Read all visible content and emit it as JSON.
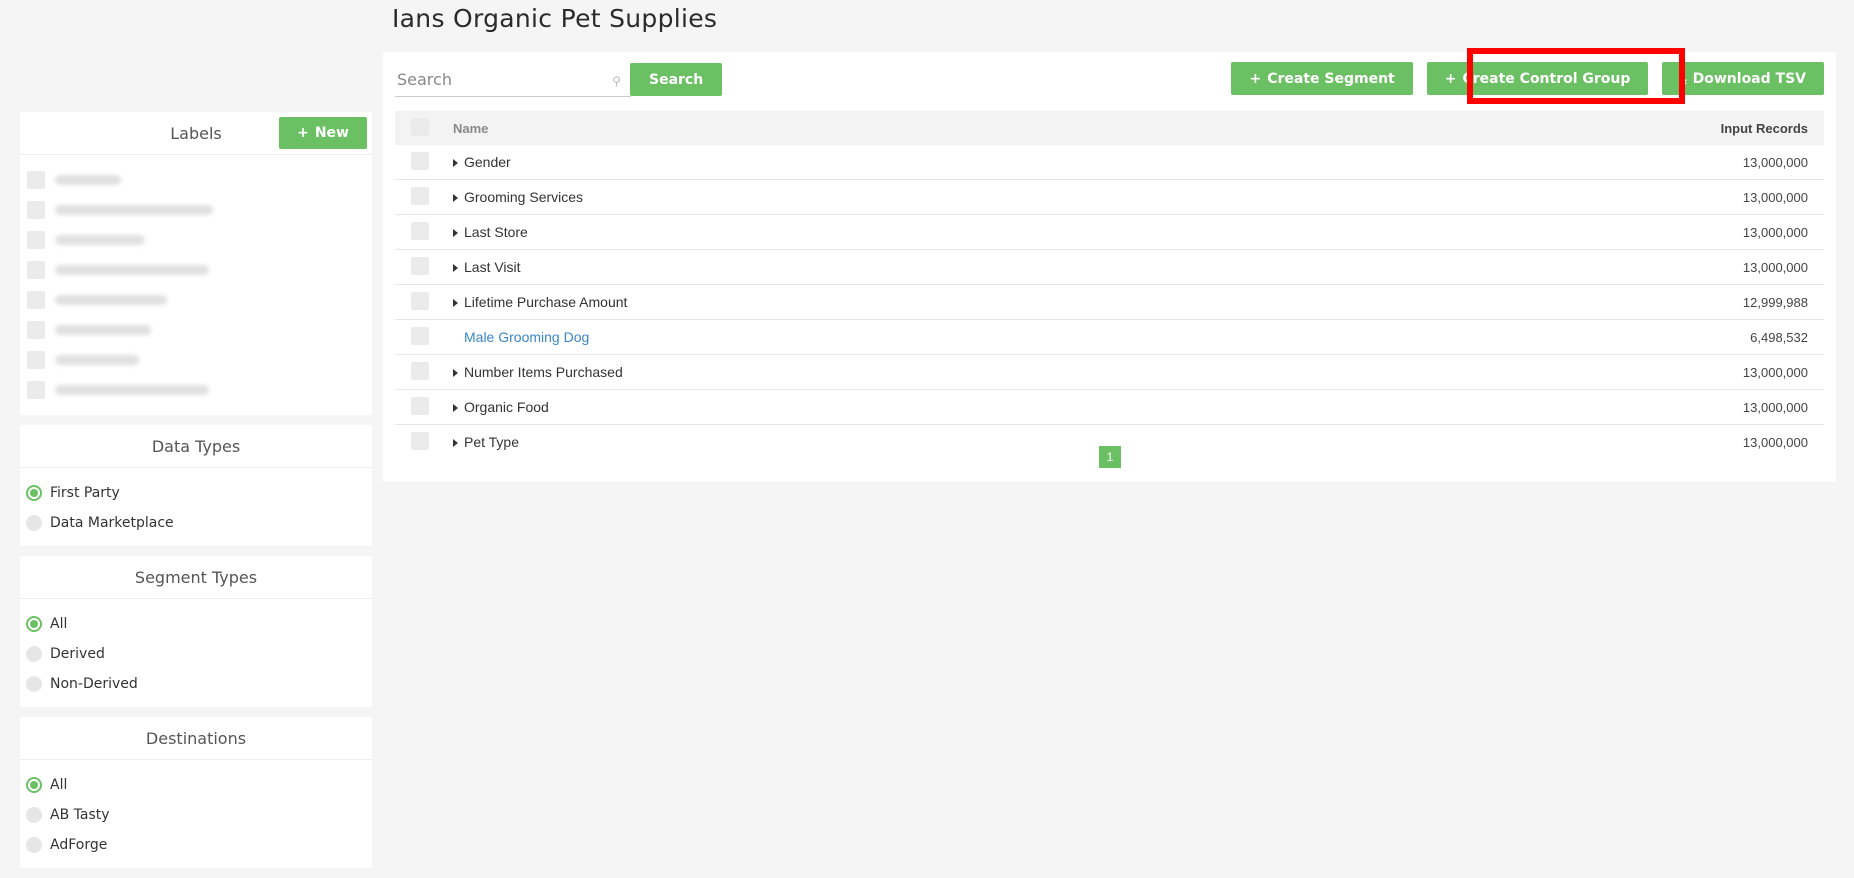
{
  "page": {
    "title": "Ians Organic Pet Supplies"
  },
  "labels": {
    "heading": "Labels",
    "new_button": "New"
  },
  "data_types": {
    "heading": "Data Types",
    "options": [
      "First Party",
      "Data Marketplace"
    ],
    "selected": "First Party"
  },
  "segment_types": {
    "heading": "Segment Types",
    "options": [
      "All",
      "Derived",
      "Non-Derived"
    ],
    "selected": "All"
  },
  "destinations": {
    "heading": "Destinations",
    "options": [
      "All",
      "AB Tasty",
      "AdForge"
    ],
    "selected": "All"
  },
  "search": {
    "placeholder": "Search",
    "button": "Search"
  },
  "actions": {
    "create_segment": "Create Segment",
    "create_control_group": "Create Control Group",
    "download_tsv": "Download TSV"
  },
  "table": {
    "columns": {
      "name": "Name",
      "records": "Input Records"
    },
    "rows": [
      {
        "name": "Gender",
        "records": "13,000,000",
        "expandable": true
      },
      {
        "name": "Grooming Services",
        "records": "13,000,000",
        "expandable": true
      },
      {
        "name": "Last Store",
        "records": "13,000,000",
        "expandable": true
      },
      {
        "name": "Last Visit",
        "records": "13,000,000",
        "expandable": true
      },
      {
        "name": "Lifetime Purchase Amount",
        "records": "12,999,988",
        "expandable": true
      },
      {
        "name": "Male Grooming Dog",
        "records": "6,498,532",
        "expandable": false
      },
      {
        "name": "Number Items Purchased",
        "records": "13,000,000",
        "expandable": true
      },
      {
        "name": "Organic Food",
        "records": "13,000,000",
        "expandable": true
      },
      {
        "name": "Pet Type",
        "records": "13,000,000",
        "expandable": true
      }
    ]
  },
  "pagination": {
    "current": "1"
  },
  "colors": {
    "accent": "#6cc064",
    "link": "#3a86c8",
    "highlight": "#ff0000"
  }
}
